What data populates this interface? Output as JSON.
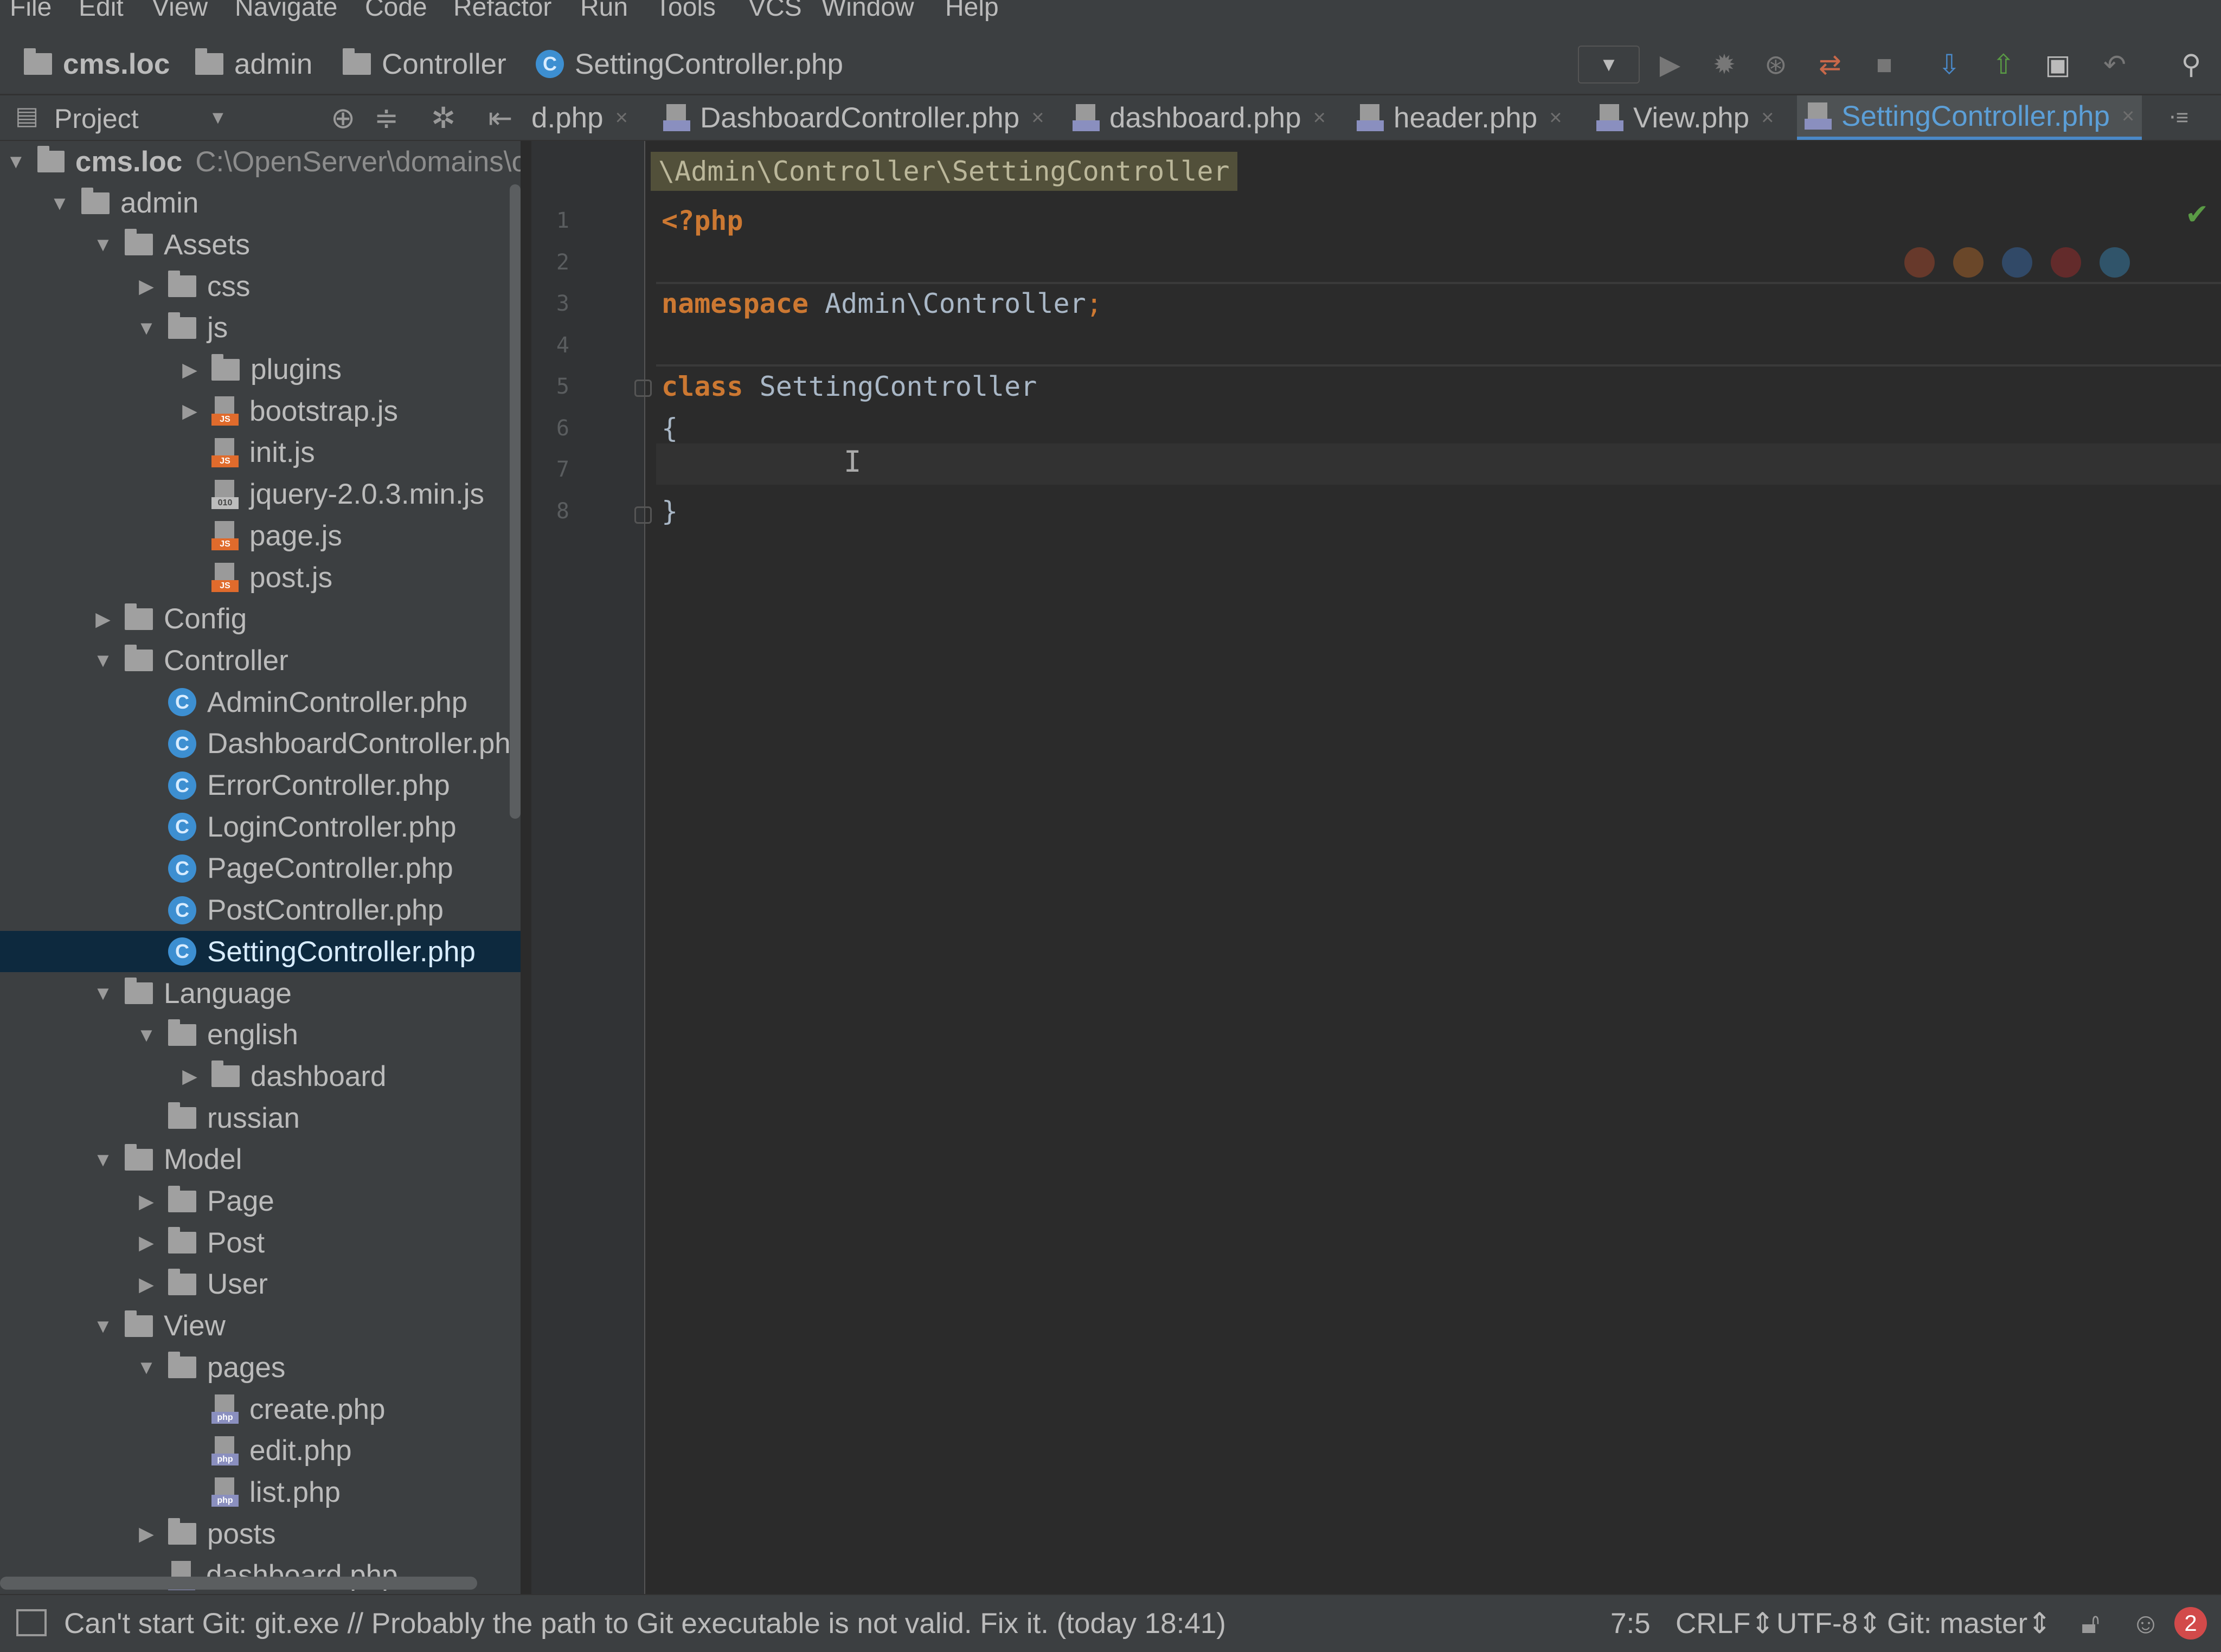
{
  "menu": [
    "File",
    "Edit",
    "View",
    "Navigate",
    "Code",
    "Refactor",
    "Run",
    "Tools",
    "VCS",
    "Window",
    "Help"
  ],
  "breadcrumbs": [
    "cms.loc",
    "admin",
    "Controller",
    "SettingController.php"
  ],
  "project_panel": {
    "label": "Project"
  },
  "tree": [
    {
      "label": "cms.loc",
      "path": "C:\\OpenServer\\domains\\c",
      "depth": 0,
      "type": "folder",
      "expanded": true
    },
    {
      "label": "admin",
      "depth": 1,
      "type": "folder",
      "expanded": true
    },
    {
      "label": "Assets",
      "depth": 2,
      "type": "folder",
      "expanded": true
    },
    {
      "label": "css",
      "depth": 3,
      "type": "folder",
      "expanded": false
    },
    {
      "label": "js",
      "depth": 3,
      "type": "folder",
      "expanded": true
    },
    {
      "label": "plugins",
      "depth": 4,
      "type": "folder",
      "expanded": false
    },
    {
      "label": "bootstrap.js",
      "depth": 4,
      "type": "js",
      "expanded": false
    },
    {
      "label": "init.js",
      "depth": 4,
      "type": "js"
    },
    {
      "label": "jquery-2.0.3.min.js",
      "depth": 4,
      "type": "minjs"
    },
    {
      "label": "page.js",
      "depth": 4,
      "type": "js"
    },
    {
      "label": "post.js",
      "depth": 4,
      "type": "js"
    },
    {
      "label": "Config",
      "depth": 2,
      "type": "folder",
      "expanded": false
    },
    {
      "label": "Controller",
      "depth": 2,
      "type": "folder",
      "expanded": true
    },
    {
      "label": "AdminController.php",
      "depth": 3,
      "type": "class"
    },
    {
      "label": "DashboardController.php",
      "depth": 3,
      "type": "class"
    },
    {
      "label": "ErrorController.php",
      "depth": 3,
      "type": "class"
    },
    {
      "label": "LoginController.php",
      "depth": 3,
      "type": "class"
    },
    {
      "label": "PageController.php",
      "depth": 3,
      "type": "class"
    },
    {
      "label": "PostController.php",
      "depth": 3,
      "type": "class"
    },
    {
      "label": "SettingController.php",
      "depth": 3,
      "type": "class",
      "selected": true
    },
    {
      "label": "Language",
      "depth": 2,
      "type": "folder",
      "expanded": true
    },
    {
      "label": "english",
      "depth": 3,
      "type": "folder",
      "expanded": true
    },
    {
      "label": "dashboard",
      "depth": 4,
      "type": "folder",
      "expanded": false
    },
    {
      "label": "russian",
      "depth": 3,
      "type": "folder"
    },
    {
      "label": "Model",
      "depth": 2,
      "type": "folder",
      "expanded": true
    },
    {
      "label": "Page",
      "depth": 3,
      "type": "folder",
      "expanded": false
    },
    {
      "label": "Post",
      "depth": 3,
      "type": "folder",
      "expanded": false
    },
    {
      "label": "User",
      "depth": 3,
      "type": "folder",
      "expanded": false
    },
    {
      "label": "View",
      "depth": 2,
      "type": "folder",
      "expanded": true
    },
    {
      "label": "pages",
      "depth": 3,
      "type": "folder",
      "expanded": true
    },
    {
      "label": "create.php",
      "depth": 4,
      "type": "php"
    },
    {
      "label": "edit.php",
      "depth": 4,
      "type": "php"
    },
    {
      "label": "list.php",
      "depth": 4,
      "type": "php"
    },
    {
      "label": "posts",
      "depth": 3,
      "type": "folder",
      "expanded": false
    },
    {
      "label": "dashboard.php",
      "depth": 3,
      "type": "php"
    }
  ],
  "tabs": [
    {
      "label": "d.php",
      "active": false,
      "icon": false
    },
    {
      "label": "DashboardController.php",
      "active": false,
      "icon": true
    },
    {
      "label": "dashboard.php",
      "active": false,
      "icon": true
    },
    {
      "label": "header.php",
      "active": false,
      "icon": true
    },
    {
      "label": "View.php",
      "active": false,
      "icon": true
    },
    {
      "label": "SettingController.php",
      "active": true,
      "icon": true
    }
  ],
  "editor": {
    "breadcrumb": "\\Admin\\Controller\\SettingController",
    "line_numbers": [
      "1",
      "2",
      "3",
      "4",
      "5",
      "6",
      "7",
      "8"
    ],
    "lines": [
      {
        "kw": "<?php",
        "rest": ""
      },
      {
        "kw": "",
        "rest": ""
      },
      {
        "kw": "namespace",
        "rest": " Admin\\Controller",
        "punct": ";"
      },
      {
        "kw": "",
        "rest": ""
      },
      {
        "kw": "class",
        "rest": " SettingController"
      },
      {
        "kw": "",
        "rest": "{"
      },
      {
        "kw": "",
        "rest": ""
      },
      {
        "kw": "",
        "rest": "}"
      }
    ]
  },
  "status": {
    "message": "Can't start Git: git.exe // Probably the path to Git executable is not valid. Fix it. (today 18:41)",
    "position": "7:5",
    "line_sep": "CRLF",
    "encoding": "UTF-8",
    "vcs": "Git: master",
    "notifications": "2"
  },
  "colors": {
    "keyword": "#cc7832",
    "accent": "#4a88c7",
    "selection": "#0d293e"
  },
  "icons": [
    "folder-icon",
    "class-icon",
    "php-file-icon",
    "js-file-icon",
    "run-icon",
    "debug-icon",
    "search-icon",
    "checkmark-icon"
  ]
}
